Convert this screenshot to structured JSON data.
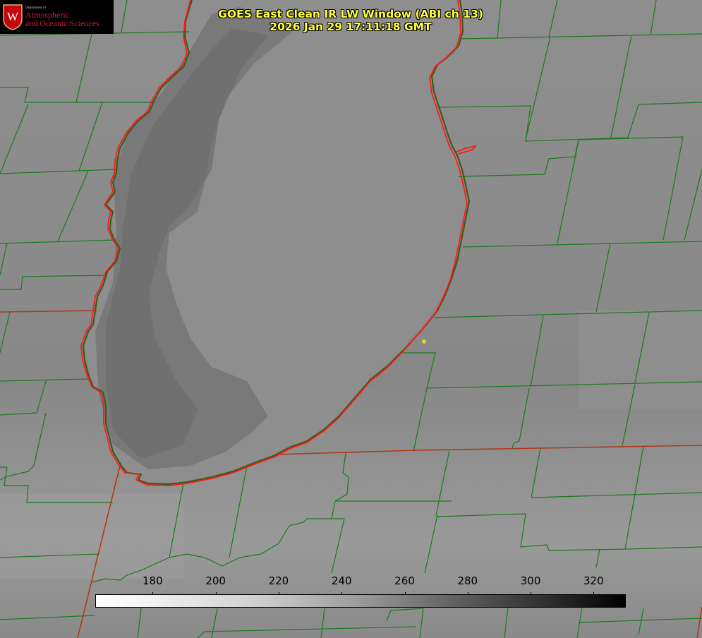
{
  "title": {
    "line1": "GOES East Clean IR LW Window (ABI ch 13)",
    "line2": "2026 Jan 29 17:11:18 GMT"
  },
  "logo": {
    "dept": "Department of",
    "line1": "Atmospheric",
    "line2": "and Oceanic Sciences",
    "seal_letter": "W"
  },
  "colorbar": {
    "min": 162,
    "max": 330,
    "ticks": [
      "180",
      "200",
      "220",
      "240",
      "260",
      "280",
      "300",
      "320"
    ]
  },
  "colors": {
    "county_lines": "#1d7a1d",
    "state_lines": "#b03a1a",
    "shoreline_red": "#ff1a1a",
    "title_text": "#ffff3a",
    "logo_red": "#d21a2e",
    "marker": "#e0d020"
  }
}
